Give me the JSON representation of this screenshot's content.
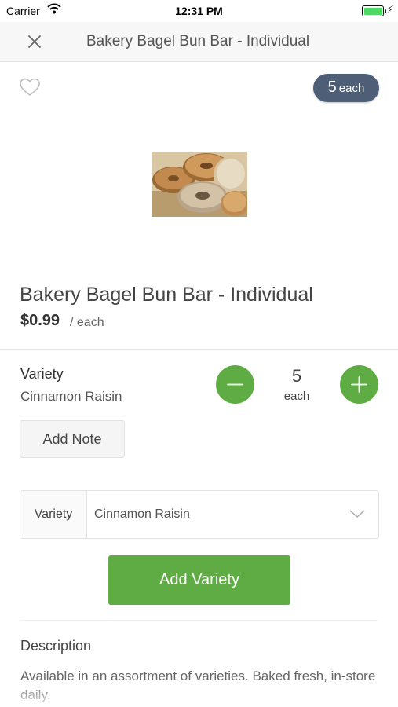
{
  "status_bar": {
    "carrier": "Carrier",
    "time": "12:31 PM"
  },
  "header": {
    "title": "Bakery Bagel Bun Bar - Individual"
  },
  "badge": {
    "count": "5",
    "unit": "each"
  },
  "product": {
    "title": "Bakery Bagel Bun Bar - Individual",
    "price": "$0.99",
    "price_unit": "/ each"
  },
  "variety": {
    "label": "Variety",
    "value": "Cinnamon Raisin"
  },
  "quantity": {
    "value": "5",
    "unit": "each"
  },
  "add_note_label": "Add Note",
  "variety_select": {
    "label": "Variety",
    "selected": "Cinnamon Raisin"
  },
  "add_variety_label": "Add Variety",
  "description": {
    "heading": "Description",
    "text": "Available in an assortment of varieties. Baked fresh, in-store daily."
  },
  "colors": {
    "accent": "#5fac45",
    "badge": "#4e5e76"
  },
  "icons": [
    "wifi-icon",
    "battery-icon",
    "close-icon",
    "heart-icon",
    "minus-icon",
    "plus-icon",
    "chevron-down-icon"
  ]
}
